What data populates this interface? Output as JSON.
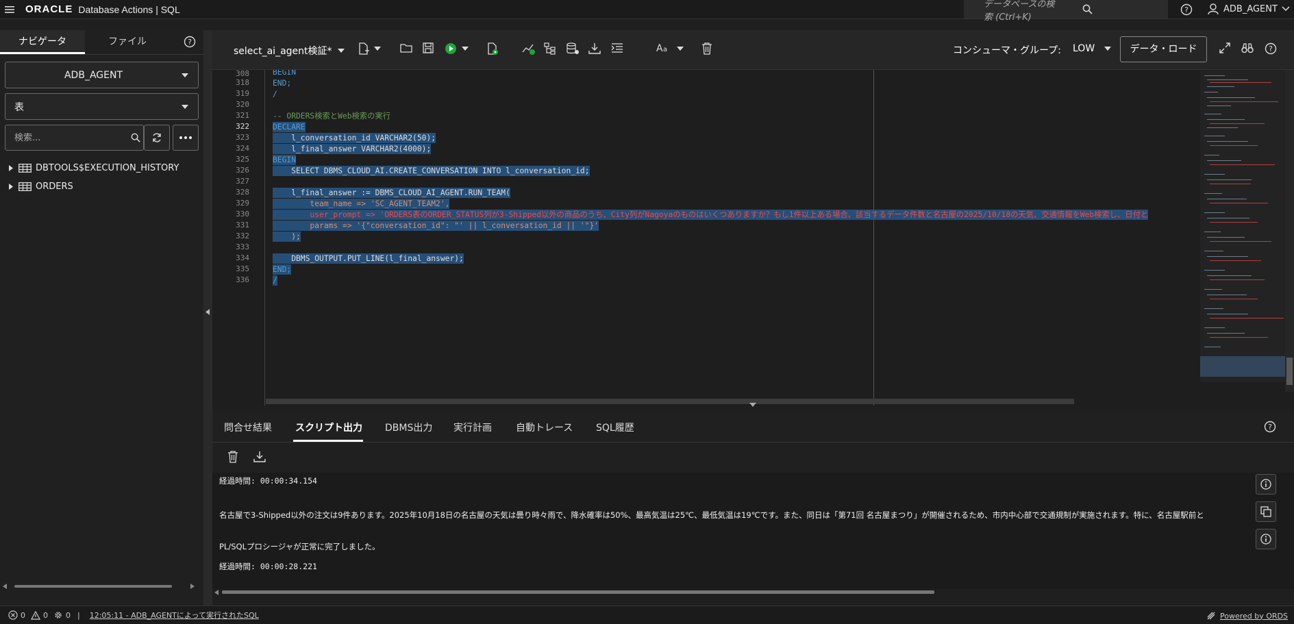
{
  "topbar": {
    "logo": "ORACLE",
    "app_title": "Database Actions |  SQL",
    "search_placeholder": "データベースの検索 (Ctrl+K)",
    "user": "ADB_AGENT"
  },
  "navigator": {
    "tabs": [
      "ナビゲータ",
      "ファイル"
    ],
    "active_tab": "ナビゲータ",
    "schema": "ADB_AGENT",
    "object_type": "表",
    "filter_placeholder": "検索...",
    "tree": [
      "DBTOOLS$EXECUTION_HISTORY",
      "ORDERS"
    ]
  },
  "editor_toolbar": {
    "file_name": "select_ai_agent検証*",
    "consumer_group_label": "コンシューマ・グループ:",
    "consumer_group_value": "LOW",
    "data_load_button": "データ・ロード"
  },
  "editor": {
    "line_numbers": [
      "308",
      "318",
      "319",
      "320",
      "321",
      "322",
      "323",
      "324",
      "325",
      "326",
      "327",
      "328",
      "329",
      "330",
      "331",
      "332",
      "333",
      "334",
      "335",
      "336"
    ],
    "current_line": "322",
    "code_lines": [
      "BEGIN",
      "END;",
      "/",
      "",
      "-- ORDERS検索とWeb検索の実行",
      "DECLARE",
      "    l_conversation_id VARCHAR2(50);",
      "    l_final_answer VARCHAR2(4000);",
      "BEGIN",
      "    SELECT DBMS_CLOUD_AI.CREATE_CONVERSATION INTO l_conversation_id;",
      "",
      "    l_final_answer := DBMS_CLOUD_AI_AGENT.RUN_TEAM(",
      "        team_name => 'SC_AGENT_TEAM2',",
      "        user_prompt => 'ORDERS表のORDER_STATUS列が3-Shipped以外の商品のうち、City列がNagoyaのものはいくつありますか？もし1件以上ある場合、該当するデータ件数と名古屋の2025/10/18の天気、交通情報をWeb検索し、日付と",
      "        params => '{\"conversation_id\": \"' || l_conversation_id || '\"}'",
      "    );",
      "",
      "    DBMS_OUTPUT.PUT_LINE(l_final_answer);",
      "END;",
      "/"
    ]
  },
  "results": {
    "tabs": [
      "問合せ結果",
      "スクリプト出力",
      "DBMS出力",
      "実行計画",
      "自動トレース",
      "SQL履歴"
    ],
    "active_tab": "スクリプト出力",
    "output_lines": [
      "経過時間: 00:00:34.154",
      "名古屋で3-Shipped以外の注文は9件あります。2025年10月18日の名古屋の天気は曇り時々雨で、降水確率は50%、最高気温は25℃、最低気温は19℃です。また、同日は「第71回 名古屋まつり」が開催されるため、市内中心部で交通規制が実施されます。特に、名古屋駅前と",
      "PL/SQLプロシージャが正常に完了しました。",
      "経過時間: 00:00:28.221"
    ]
  },
  "statusbar": {
    "errors": "0",
    "warnings": "0",
    "tasks": "0",
    "separator": "|",
    "last_run": "12:05:11 - ADB_AGENTによって実行されたSQL",
    "powered_by": "Powered by ORDS"
  }
}
